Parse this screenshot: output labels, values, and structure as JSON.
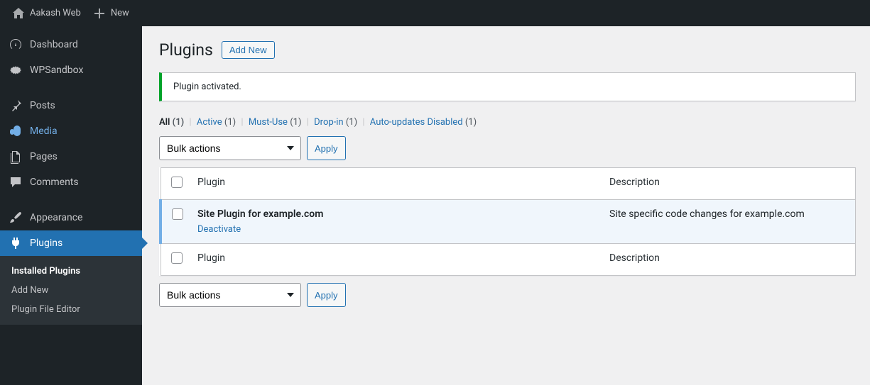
{
  "topbar": {
    "site_name": "Aakash Web",
    "new_label": "New"
  },
  "sidebar": {
    "dashboard": "Dashboard",
    "wpsandbox": "WPSandbox",
    "posts": "Posts",
    "media": "Media",
    "pages": "Pages",
    "comments": "Comments",
    "appearance": "Appearance",
    "plugins": "Plugins",
    "submenu": {
      "installed": "Installed Plugins",
      "add_new": "Add New",
      "editor": "Plugin File Editor"
    }
  },
  "page": {
    "title": "Plugins",
    "add_new": "Add New"
  },
  "notice": {
    "text": "Plugin activated."
  },
  "filters": {
    "all_label": "All",
    "all_count": "(1)",
    "active_label": "Active",
    "active_count": "(1)",
    "mustuse_label": "Must-Use",
    "mustuse_count": "(1)",
    "dropin_label": "Drop-in",
    "dropin_count": "(1)",
    "auto_label": "Auto-updates Disabled",
    "auto_count": "(1)"
  },
  "bulk": {
    "select_value": "Bulk actions",
    "apply": "Apply"
  },
  "table": {
    "col_plugin": "Plugin",
    "col_desc": "Description",
    "row": {
      "name": "Site Plugin for example.com",
      "deactivate": "Deactivate",
      "desc": "Site specific code changes for example.com"
    }
  }
}
